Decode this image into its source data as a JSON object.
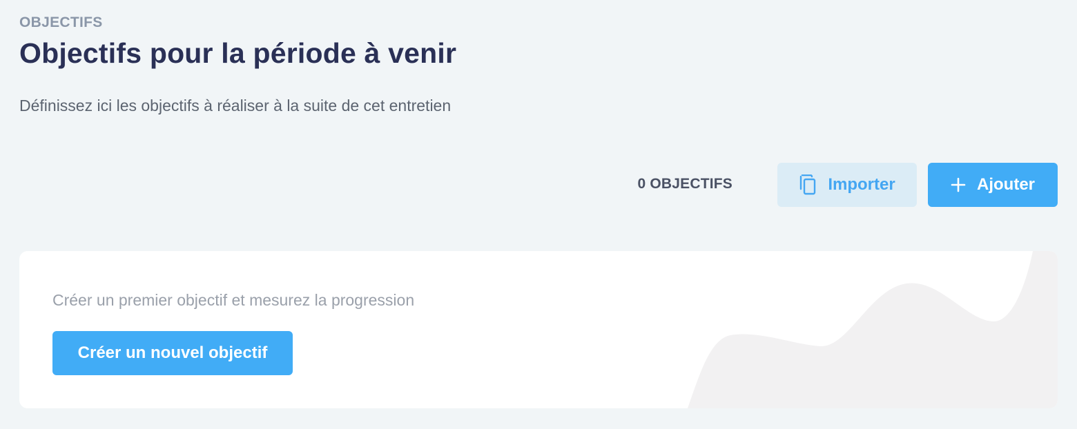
{
  "header": {
    "section_label": "OBJECTIFS",
    "title": "Objectifs pour la période à venir",
    "subtitle": "Définissez ici les objectifs à réaliser à la suite de cet entretien"
  },
  "toolbar": {
    "count_label": "0 OBJECTIFS",
    "import_label": "Importer",
    "import_icon": "copy-icon",
    "add_label": "Ajouter",
    "add_icon": "plus-icon"
  },
  "empty_state": {
    "message": "Créer un premier objectif et mesurez la progression",
    "create_label": "Créer un nouvel objectif"
  },
  "colors": {
    "background": "#f1f5f7",
    "title": "#2a3056",
    "accent": "#41acf6",
    "accent_light": "#dbecf6"
  }
}
